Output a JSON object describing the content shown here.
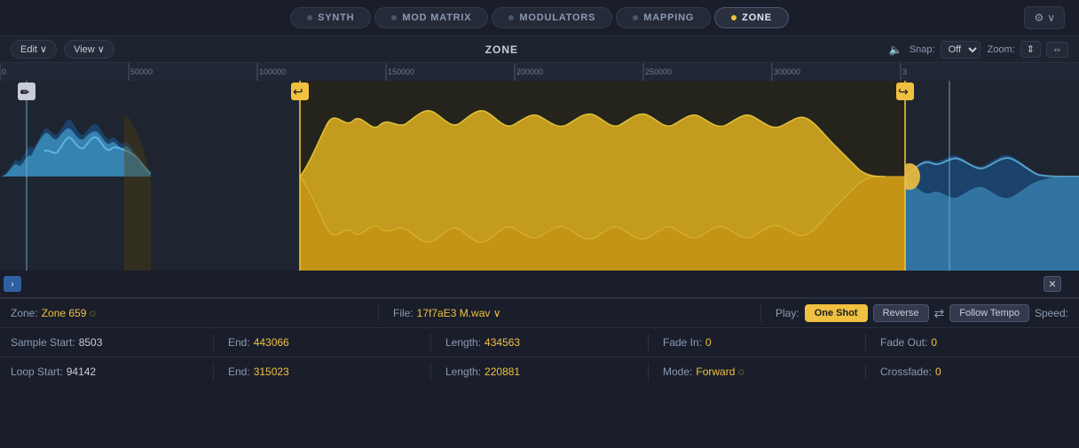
{
  "nav": {
    "tabs": [
      {
        "id": "synth",
        "label": "SYNTH",
        "active": false,
        "dot_active": false
      },
      {
        "id": "mod-matrix",
        "label": "MOD MATRIX",
        "active": false,
        "dot_active": false
      },
      {
        "id": "modulators",
        "label": "MODULATORS",
        "active": false,
        "dot_active": false
      },
      {
        "id": "mapping",
        "label": "MAPPING",
        "active": false,
        "dot_active": false
      },
      {
        "id": "zone",
        "label": "ZONE",
        "active": true,
        "dot_active": true
      }
    ],
    "settings_label": "⚙ ∨"
  },
  "toolbar": {
    "edit_label": "Edit ∨",
    "view_label": "View ∨",
    "title": "ZONE",
    "snap_label": "Snap:",
    "snap_value": "Off",
    "zoom_label": "Zoom:",
    "zoom_fit_icon": "⇕",
    "zoom_full_icon": "⇔"
  },
  "waveform": {
    "ruler_marks": [
      "0",
      "50000",
      "100000",
      "150000",
      "200000",
      "250000",
      "300000",
      "3"
    ]
  },
  "info_row1": {
    "zone_label": "Zone:",
    "zone_value": "Zone 659 ◌",
    "file_label": "File:",
    "file_value": "17f7aE3 M.wav ∨",
    "play_label": "Play:",
    "oneshot_label": "One Shot",
    "reverse_label": "Reverse",
    "loop_icon": "⇄",
    "follow_tempo_label": "Follow Tempo",
    "speed_label": "Speed:"
  },
  "info_row2": {
    "sample_start_label": "Sample Start:",
    "sample_start_value": "8503",
    "end_label": "End:",
    "end_value": "443066",
    "length_label": "Length:",
    "length_value": "434563",
    "fade_in_label": "Fade In:",
    "fade_in_value": "0",
    "fade_out_label": "Fade Out:",
    "fade_out_value": "0"
  },
  "info_row3": {
    "loop_start_label": "Loop Start:",
    "loop_start_value": "94142",
    "end_label": "End:",
    "end_value": "315023",
    "length_label": "Length:",
    "length_value": "220881",
    "mode_label": "Mode:",
    "mode_value": "Forward ◌",
    "crossfade_label": "Crossfade:",
    "crossfade_value": "0"
  },
  "colors": {
    "accent": "#f0c040",
    "blue_wave": "#5090c0",
    "blue_wave_light": "#70b8e8",
    "yellow_wave": "#f0c040",
    "bg_dark": "#1a1e2a",
    "bg_mid": "#1e2330",
    "active_btn": "#f0c040"
  }
}
